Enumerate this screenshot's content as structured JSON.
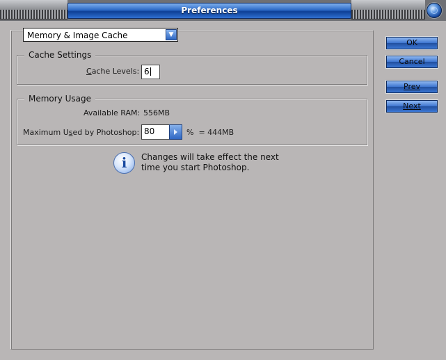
{
  "window": {
    "title": "Preferences"
  },
  "section_select": {
    "value": "Memory & Image Cache"
  },
  "cache_settings": {
    "legend": "Cache Settings",
    "cache_levels_label_underlined": "C",
    "cache_levels_label_rest": "ache Levels:",
    "cache_levels_value": "6"
  },
  "memory_usage": {
    "legend": "Memory Usage",
    "available_ram_label": "Available RAM:",
    "available_ram_value": "556MB",
    "max_used_label_pre": "Maximum U",
    "max_used_label_underlined": "s",
    "max_used_label_post": "ed by Photoshop:",
    "max_used_value": "80",
    "percent_suffix": "%  = 444MB"
  },
  "notice": {
    "line1": "Changes will take effect the next",
    "line2": "time you start Photoshop."
  },
  "buttons": {
    "ok": "OK",
    "cancel": "Cancel",
    "prev": "Prev",
    "next": "Next"
  },
  "icons": {
    "info": "info-icon",
    "dropdown": "chevron-down-icon",
    "stepper": "chevron-right-icon",
    "close": "close-icon"
  }
}
